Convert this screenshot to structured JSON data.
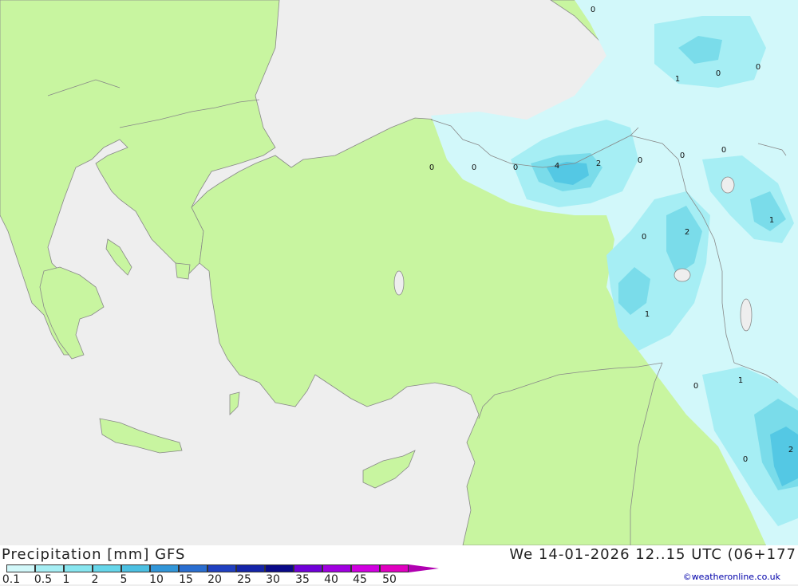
{
  "colors": {
    "sea": "#eeeeee",
    "land": "#c8f5a0",
    "precip_light": "#d2f8fa",
    "precip_mid": "#a6eef4",
    "precip_heavy": "#7adcea",
    "precip_max": "#54c8e4",
    "border": "#888888"
  },
  "footer": {
    "legend_title": "Precipitation [mm] GFS",
    "valid_time": "We 14-01-2026 12..15 UTC (06+177",
    "credit": "©weatheronline.co.uk"
  },
  "legend": {
    "labels": [
      "0.1",
      "0.5",
      "1",
      "2",
      "5",
      "10",
      "15",
      "20",
      "25",
      "30",
      "35",
      "40",
      "45",
      "50"
    ],
    "colors": [
      "#d2f8fa",
      "#a6eef4",
      "#88e6f0",
      "#66d6ea",
      "#4cc0e2",
      "#3296d8",
      "#2a6ed0",
      "#2040c0",
      "#1424a8",
      "#0a0a88",
      "#7000d8",
      "#a000e0",
      "#d000e0",
      "#e000c0",
      "#b000b0"
    ]
  },
  "map_values": [
    "0",
    "0",
    "0",
    "4",
    "2",
    "0",
    "0",
    "0",
    "1",
    "0",
    "0",
    "0",
    "2",
    "1",
    "1",
    "0",
    "1",
    "0",
    "2"
  ]
}
